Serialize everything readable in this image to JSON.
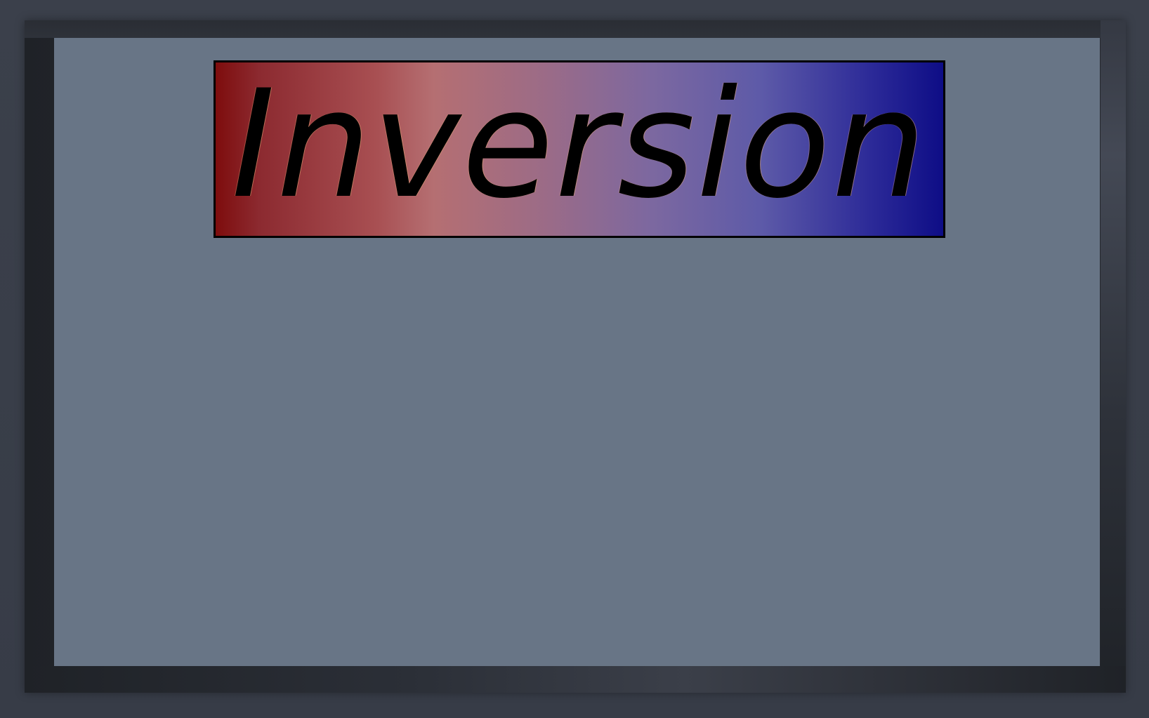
{
  "game": {
    "title": "Inversion"
  },
  "colors": {
    "board": "#687586",
    "frame": "#2a2e36",
    "banner_left": "#7e0d0d",
    "banner_right": "#0e0d86",
    "title_text": "#000000"
  }
}
